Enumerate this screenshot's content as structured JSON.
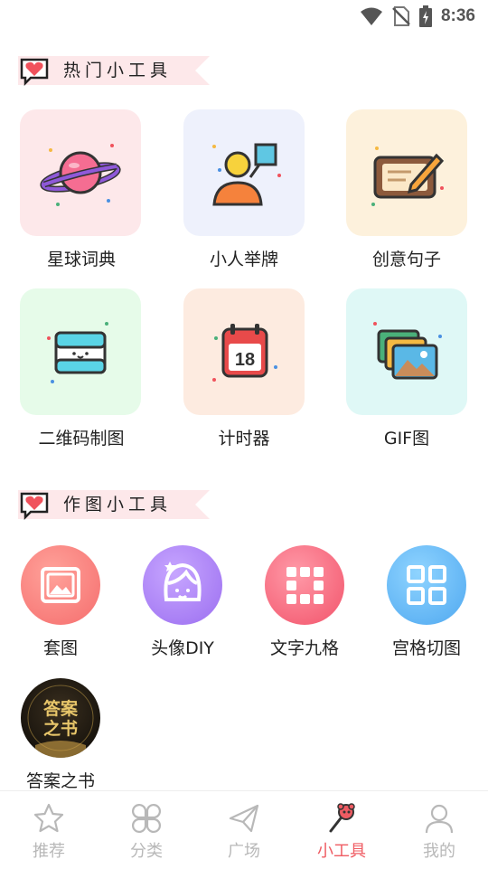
{
  "status_bar": {
    "time": "8:36"
  },
  "sections": [
    {
      "title": "热门小工具"
    },
    {
      "title": "作图小工具"
    }
  ],
  "hot_tools": [
    {
      "label": "星球词典",
      "icon": "planet-icon",
      "bg": "#fde8ea"
    },
    {
      "label": "小人举牌",
      "icon": "person-sign-icon",
      "bg": "#eef1fc"
    },
    {
      "label": "创意句子",
      "icon": "tablet-pen-icon",
      "bg": "#fdf1dc"
    },
    {
      "label": "二维码制图",
      "icon": "qr-scan-icon",
      "bg": "#e6fbe9"
    },
    {
      "label": "计时器",
      "icon": "calendar-icon",
      "bg": "#fdebe0"
    },
    {
      "label": "GIF图",
      "icon": "gif-images-icon",
      "bg": "#dff8f6"
    }
  ],
  "calendar_day": "18",
  "drawing_tools": [
    {
      "label": "套图",
      "icon": "picture-frame-icon"
    },
    {
      "label": "头像DIY",
      "icon": "avatar-face-icon"
    },
    {
      "label": "文字九格",
      "icon": "nine-grid-icon"
    },
    {
      "label": "宫格切图",
      "icon": "grid-cut-icon"
    },
    {
      "label": "答案之书",
      "icon": "answer-book-icon",
      "image_text": "答案之书"
    }
  ],
  "bottom_nav": [
    {
      "label": "推荐",
      "icon": "star-icon",
      "active": false
    },
    {
      "label": "分类",
      "icon": "category-icon",
      "active": false
    },
    {
      "label": "广场",
      "icon": "paper-plane-icon",
      "active": false
    },
    {
      "label": "小工具",
      "icon": "tools-icon",
      "active": true
    },
    {
      "label": "我的",
      "icon": "profile-icon",
      "active": false
    }
  ],
  "colors": {
    "accent": "#ef5b62",
    "inactive": "#b8b8b8"
  }
}
